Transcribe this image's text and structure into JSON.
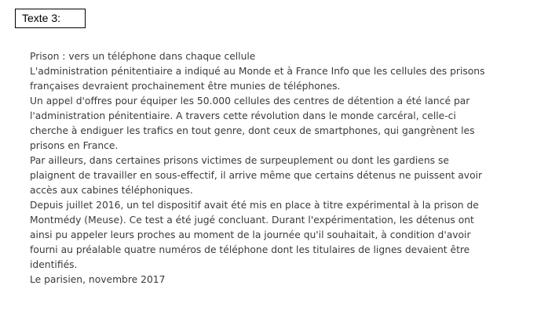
{
  "label": "Texte 3:",
  "lines": [
    "Prison : vers un téléphone dans chaque cellule",
    "L'administration pénitentiaire a indiqué au Monde et à France Info que les cellules des prisons",
    "françaises devraient prochainement être munies de téléphones.",
    "Un appel d'offres pour équiper les 50.000 cellules des centres de détention a été lancé par",
    "l'administration pénitentiaire. A travers cette révolution dans le monde carcéral, celle-ci",
    "cherche à endiguer les trafics en tout genre, dont ceux de smartphones, qui gangrènent les",
    "prisons en France.",
    "Par ailleurs, dans certaines prisons victimes de surpeuplement ou dont les gardiens se",
    "plaignent de travailler en sous-effectif, il arrive même que certains détenus ne puissent avoir",
    "accès aux cabines téléphoniques.",
    "Depuis juillet 2016, un tel dispositif avait été mis en place à titre expérimental à la prison de",
    "Montmédy (Meuse). Ce test a été jugé concluant. Durant l'expérimentation, les détenus ont",
    "ainsi pu appeler leurs proches au moment de la journée qu'il souhaitait, à condition d'avoir",
    "fourni au préalable quatre numéros de téléphone dont les titulaires de lignes devaient être",
    "identifiés.",
    "Le parisien, novembre 2017"
  ]
}
